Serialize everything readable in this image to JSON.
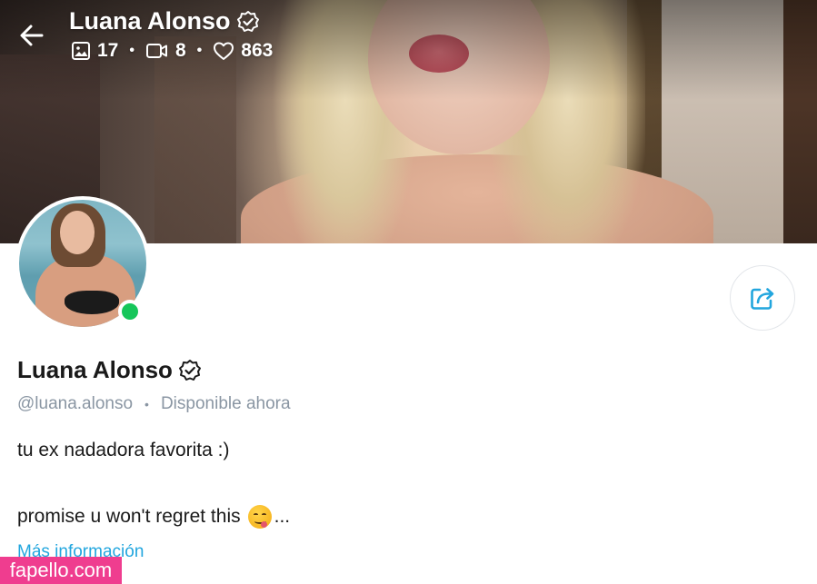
{
  "header": {
    "name": "Luana Alonso",
    "stats": {
      "photos": "17",
      "videos": "8",
      "likes": "863"
    },
    "icons": {
      "back": "arrow-left-icon",
      "verified": "verified-badge-icon",
      "photos": "image-icon",
      "videos": "video-icon",
      "likes": "heart-icon"
    }
  },
  "profile": {
    "name": "Luana Alonso",
    "handle": "@luana.alonso",
    "status": "Disponible ahora",
    "bio_line1": "tu ex nadadora favorita :)",
    "bio_line2": "promise u won't regret this",
    "bio_ellipsis": "...",
    "more_info": "Más información",
    "online": true
  },
  "actions": {
    "share_icon": "share-icon"
  },
  "watermark": "fapello.com",
  "colors": {
    "accent": "#22a6de",
    "online": "#16c65a",
    "muted_text": "#8a96a3",
    "watermark_bg": "#ef3d8f"
  }
}
